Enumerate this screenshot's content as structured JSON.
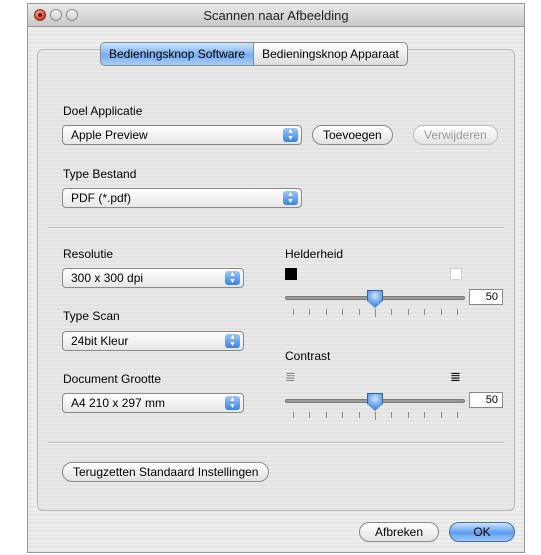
{
  "window": {
    "title": "Scannen naar Afbeelding"
  },
  "tabs": [
    {
      "label": "Bedieningsknop Software",
      "active": true
    },
    {
      "label": "Bedieningsknop Apparaat",
      "active": false
    }
  ],
  "application": {
    "label": "Doel Applicatie",
    "value": "Apple Preview",
    "add_label": "Toevoegen",
    "remove_label": "Verwijderen"
  },
  "filetype": {
    "label": "Type Bestand",
    "value": "PDF (*.pdf)"
  },
  "resolution": {
    "label": "Resolutie",
    "value": "300 x 300 dpi"
  },
  "scantype": {
    "label": "Type Scan",
    "value": "24bit Kleur"
  },
  "docsize": {
    "label": "Document Grootte",
    "value": "A4 210 x 297 mm"
  },
  "brightness": {
    "label": "Helderheid",
    "value": "50",
    "level": 0.5
  },
  "contrast": {
    "label": "Contrast",
    "value": "50",
    "level": 0.5
  },
  "reset_label": "Terugzetten Standaard Instellingen",
  "footer": {
    "cancel_label": "Afbreken",
    "ok_label": "OK"
  },
  "icons": {
    "popup_arrows": "updown-arrows-icon",
    "brightness_low": "black-square-icon",
    "brightness_high": "white-square-icon",
    "contrast_low": "low-contrast-lines-icon",
    "contrast_high": "high-contrast-lines-icon"
  },
  "colors": {
    "accent": "#5c9ef0",
    "active_tab": "#78aef0"
  }
}
